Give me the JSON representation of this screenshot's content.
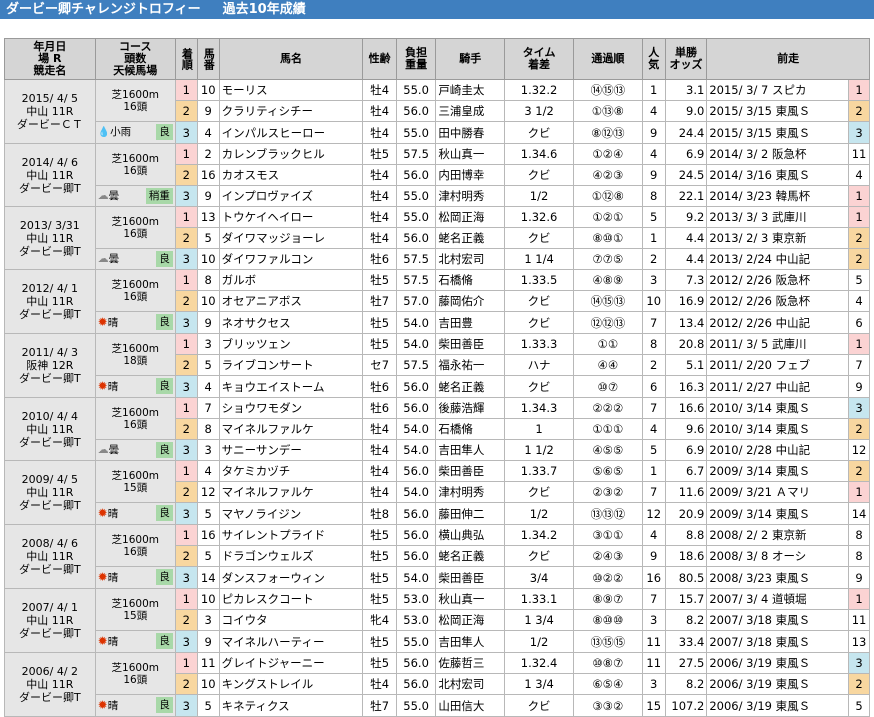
{
  "title": "ダービー卿チャレンジトロフィー",
  "subtitle": "過去10年成績",
  "headers": {
    "date": [
      "年月日",
      "場 R",
      "競走名"
    ],
    "course": [
      "コース",
      "頭数",
      "天候馬場"
    ],
    "pos": "着順",
    "num": "馬番",
    "horse": "馬名",
    "sexage": "性齢",
    "weight": [
      "負担",
      "重量"
    ],
    "jockey": "騎手",
    "time": [
      "タイム",
      "着差"
    ],
    "passing": "通過順",
    "pop": [
      "人",
      "気"
    ],
    "odds": [
      "単勝",
      "オッズ"
    ],
    "prev": "前走"
  },
  "races": [
    {
      "date": "2015/ 4/ 5",
      "venue": "中山 11R",
      "race": "ダービーＣＴ",
      "course": "芝1600m",
      "heads": "16頭",
      "weather": "小雨",
      "weather_icon": "rain-icon",
      "cond": "良",
      "rows": [
        {
          "pos": "1",
          "num": "10",
          "horse": "モーリス",
          "sa": "牡4",
          "wt": "55.0",
          "jockey": "戸崎圭太",
          "time": "1.32.2",
          "pass": "⑭⑮⑬",
          "pop": "1",
          "odds": "3.1",
          "prev": "2015/ 3/ 7 スピカ",
          "prevpos": "1"
        },
        {
          "pos": "2",
          "num": "9",
          "horse": "クラリティシチー",
          "sa": "牡4",
          "wt": "56.0",
          "jockey": "三浦皇成",
          "time": "3 1/2",
          "pass": "①⑬⑧",
          "pop": "4",
          "odds": "9.0",
          "prev": "2015/ 3/15 東風Ｓ",
          "prevpos": "2"
        },
        {
          "pos": "3",
          "num": "4",
          "horse": "インパルスヒーロー",
          "sa": "牡4",
          "wt": "55.0",
          "jockey": "田中勝春",
          "time": "クビ",
          "pass": "⑧⑫⑬",
          "pop": "9",
          "odds": "24.4",
          "prev": "2015/ 3/15 東風Ｓ",
          "prevpos": "3"
        }
      ]
    },
    {
      "date": "2014/ 4/ 6",
      "venue": "中山 11R",
      "race": "ダービー卿T",
      "course": "芝1600m",
      "heads": "16頭",
      "weather": "曇",
      "weather_icon": "cloud-icon",
      "cond": "稍重",
      "rows": [
        {
          "pos": "1",
          "num": "2",
          "horse": "カレンブラックヒル",
          "sa": "牡5",
          "wt": "57.5",
          "jockey": "秋山真一",
          "time": "1.34.6",
          "pass": "①②④",
          "pop": "4",
          "odds": "6.9",
          "prev": "2014/ 3/ 2 阪急杯",
          "prevpos": "11"
        },
        {
          "pos": "2",
          "num": "16",
          "horse": "カオスモス",
          "sa": "牡4",
          "wt": "56.0",
          "jockey": "内田博幸",
          "time": "クビ",
          "pass": "④②③",
          "pop": "9",
          "odds": "24.5",
          "prev": "2014/ 3/16 東風Ｓ",
          "prevpos": "4"
        },
        {
          "pos": "3",
          "num": "9",
          "horse": "インプロヴァイズ",
          "sa": "牡4",
          "wt": "55.0",
          "jockey": "津村明秀",
          "time": "1/2",
          "pass": "①⑫⑧",
          "pop": "8",
          "odds": "22.1",
          "prev": "2014/ 3/23 韓馬杯",
          "prevpos": "1"
        }
      ]
    },
    {
      "date": "2013/ 3/31",
      "venue": "中山 11R",
      "race": "ダービー卿T",
      "course": "芝1600m",
      "heads": "16頭",
      "weather": "曇",
      "weather_icon": "cloud-icon",
      "cond": "良",
      "rows": [
        {
          "pos": "1",
          "num": "13",
          "horse": "トウケイヘイロー",
          "sa": "牡4",
          "wt": "55.0",
          "jockey": "松岡正海",
          "time": "1.32.6",
          "pass": "①②①",
          "pop": "5",
          "odds": "9.2",
          "prev": "2013/ 3/ 3 武庫川",
          "prevpos": "1"
        },
        {
          "pos": "2",
          "num": "5",
          "horse": "ダイワマッジョーレ",
          "sa": "牡4",
          "wt": "56.0",
          "jockey": "蛯名正義",
          "time": "クビ",
          "pass": "⑧⑩①",
          "pop": "1",
          "odds": "4.4",
          "prev": "2013/ 2/ 3 東京新",
          "prevpos": "2"
        },
        {
          "pos": "3",
          "num": "10",
          "horse": "ダイワファルコン",
          "sa": "牡6",
          "wt": "57.5",
          "jockey": "北村宏司",
          "time": "1 1/4",
          "pass": "⑦⑦⑤",
          "pop": "2",
          "odds": "4.4",
          "prev": "2013/ 2/24 中山記",
          "prevpos": "2"
        }
      ]
    },
    {
      "date": "2012/ 4/ 1",
      "venue": "中山 11R",
      "race": "ダービー卿T",
      "course": "芝1600m",
      "heads": "16頭",
      "weather": "晴",
      "weather_icon": "sun-icon",
      "cond": "良",
      "rows": [
        {
          "pos": "1",
          "num": "8",
          "horse": "ガルボ",
          "sa": "牡5",
          "wt": "57.5",
          "jockey": "石橋脩",
          "time": "1.33.5",
          "pass": "④⑧⑨",
          "pop": "3",
          "odds": "7.3",
          "prev": "2012/ 2/26 阪急杯",
          "prevpos": "5"
        },
        {
          "pos": "2",
          "num": "10",
          "horse": "オセアニアボス",
          "sa": "牡7",
          "wt": "57.0",
          "jockey": "藤岡佑介",
          "time": "クビ",
          "pass": "⑭⑮⑬",
          "pop": "10",
          "odds": "16.9",
          "prev": "2012/ 2/26 阪急杯",
          "prevpos": "4"
        },
        {
          "pos": "3",
          "num": "9",
          "horse": "ネオサクセス",
          "sa": "牡5",
          "wt": "54.0",
          "jockey": "吉田豊",
          "time": "クビ",
          "pass": "⑫⑫⑬",
          "pop": "7",
          "odds": "13.4",
          "prev": "2012/ 2/26 中山記",
          "prevpos": "6"
        }
      ]
    },
    {
      "date": "2011/ 4/ 3",
      "venue": "阪神 12R",
      "race": "ダービー卿T",
      "course": "芝1600m",
      "heads": "18頭",
      "weather": "晴",
      "weather_icon": "sun-icon",
      "cond": "良",
      "rows": [
        {
          "pos": "1",
          "num": "3",
          "horse": "ブリッツェン",
          "sa": "牡5",
          "wt": "54.0",
          "jockey": "柴田善臣",
          "time": "1.33.3",
          "pass": "①①",
          "pop": "8",
          "odds": "20.8",
          "prev": "2011/ 3/ 5 武庫川",
          "prevpos": "1"
        },
        {
          "pos": "2",
          "num": "5",
          "horse": "ライブコンサート",
          "sa": "セ7",
          "wt": "57.5",
          "jockey": "福永祐一",
          "time": "ハナ",
          "pass": "④④",
          "pop": "2",
          "odds": "5.1",
          "prev": "2011/ 2/20 フェブ",
          "prevpos": "7"
        },
        {
          "pos": "3",
          "num": "4",
          "horse": "キョウエイストーム",
          "sa": "牡6",
          "wt": "56.0",
          "jockey": "蛯名正義",
          "time": "クビ",
          "pass": "⑩⑦",
          "pop": "6",
          "odds": "16.3",
          "prev": "2011/ 2/27 中山記",
          "prevpos": "9"
        }
      ]
    },
    {
      "date": "2010/ 4/ 4",
      "venue": "中山 11R",
      "race": "ダービー卿T",
      "course": "芝1600m",
      "heads": "16頭",
      "weather": "曇",
      "weather_icon": "cloud-icon",
      "cond": "良",
      "rows": [
        {
          "pos": "1",
          "num": "7",
          "horse": "ショウワモダン",
          "sa": "牡6",
          "wt": "56.0",
          "jockey": "後藤浩輝",
          "time": "1.34.3",
          "pass": "②②②",
          "pop": "7",
          "odds": "16.6",
          "prev": "2010/ 3/14 東風Ｓ",
          "prevpos": "3"
        },
        {
          "pos": "2",
          "num": "8",
          "horse": "マイネルファルケ",
          "sa": "牡4",
          "wt": "54.0",
          "jockey": "石橋脩",
          "time": "1",
          "pass": "①①①",
          "pop": "4",
          "odds": "9.6",
          "prev": "2010/ 3/14 東風Ｓ",
          "prevpos": "2"
        },
        {
          "pos": "3",
          "num": "3",
          "horse": "サニーサンデー",
          "sa": "牡4",
          "wt": "54.0",
          "jockey": "吉田隼人",
          "time": "1 1/2",
          "pass": "④⑤⑤",
          "pop": "5",
          "odds": "6.9",
          "prev": "2010/ 2/28 中山記",
          "prevpos": "12"
        }
      ]
    },
    {
      "date": "2009/ 4/ 5",
      "venue": "中山 11R",
      "race": "ダービー卿T",
      "course": "芝1600m",
      "heads": "15頭",
      "weather": "晴",
      "weather_icon": "sun-icon",
      "cond": "良",
      "rows": [
        {
          "pos": "1",
          "num": "4",
          "horse": "タケミカヅチ",
          "sa": "牡4",
          "wt": "56.0",
          "jockey": "柴田善臣",
          "time": "1.33.7",
          "pass": "⑤⑥⑤",
          "pop": "1",
          "odds": "6.7",
          "prev": "2009/ 3/14 東風Ｓ",
          "prevpos": "2"
        },
        {
          "pos": "2",
          "num": "12",
          "horse": "マイネルファルケ",
          "sa": "牡4",
          "wt": "54.0",
          "jockey": "津村明秀",
          "time": "クビ",
          "pass": "②③②",
          "pop": "7",
          "odds": "11.6",
          "prev": "2009/ 3/21 Ａマリ",
          "prevpos": "1"
        },
        {
          "pos": "3",
          "num": "5",
          "horse": "マヤノライジン",
          "sa": "牡8",
          "wt": "56.0",
          "jockey": "藤田伸二",
          "time": "1/2",
          "pass": "⑬⑬⑫",
          "pop": "12",
          "odds": "20.9",
          "prev": "2009/ 3/14 東風Ｓ",
          "prevpos": "14"
        }
      ]
    },
    {
      "date": "2008/ 4/ 6",
      "venue": "中山 11R",
      "race": "ダービー卿T",
      "course": "芝1600m",
      "heads": "16頭",
      "weather": "晴",
      "weather_icon": "sun-icon",
      "cond": "良",
      "rows": [
        {
          "pos": "1",
          "num": "16",
          "horse": "サイレントプライド",
          "sa": "牡5",
          "wt": "56.0",
          "jockey": "横山典弘",
          "time": "1.34.2",
          "pass": "③①①",
          "pop": "4",
          "odds": "8.8",
          "prev": "2008/ 2/ 2 東京新",
          "prevpos": "8"
        },
        {
          "pos": "2",
          "num": "5",
          "horse": "ドラゴンウェルズ",
          "sa": "牡5",
          "wt": "56.0",
          "jockey": "蛯名正義",
          "time": "クビ",
          "pass": "②④③",
          "pop": "9",
          "odds": "18.6",
          "prev": "2008/ 3/ 8 オーシ",
          "prevpos": "8"
        },
        {
          "pos": "3",
          "num": "14",
          "horse": "ダンスフォーウィン",
          "sa": "牡5",
          "wt": "54.0",
          "jockey": "柴田善臣",
          "time": "3/4",
          "pass": "⑩②②",
          "pop": "16",
          "odds": "80.5",
          "prev": "2008/ 3/23 東風Ｓ",
          "prevpos": "9"
        }
      ]
    },
    {
      "date": "2007/ 4/ 1",
      "venue": "中山 11R",
      "race": "ダービー卿T",
      "course": "芝1600m",
      "heads": "15頭",
      "weather": "晴",
      "weather_icon": "sun-icon",
      "cond": "良",
      "rows": [
        {
          "pos": "1",
          "num": "10",
          "horse": "ピカレスクコート",
          "sa": "牡5",
          "wt": "53.0",
          "jockey": "秋山真一",
          "time": "1.33.1",
          "pass": "⑧⑨⑦",
          "pop": "7",
          "odds": "15.7",
          "prev": "2007/ 3/ 4 道頓堀",
          "prevpos": "1"
        },
        {
          "pos": "2",
          "num": "3",
          "horse": "コイウタ",
          "sa": "牝4",
          "wt": "53.0",
          "jockey": "松岡正海",
          "time": "1 3/4",
          "pass": "⑧⑩⑩",
          "pop": "3",
          "odds": "8.2",
          "prev": "2007/ 3/18 東風Ｓ",
          "prevpos": "11"
        },
        {
          "pos": "3",
          "num": "9",
          "horse": "マイネルハーティー",
          "sa": "牡5",
          "wt": "55.0",
          "jockey": "吉田隼人",
          "time": "1/2",
          "pass": "⑬⑮⑮",
          "pop": "11",
          "odds": "33.4",
          "prev": "2007/ 3/18 東風Ｓ",
          "prevpos": "13"
        }
      ]
    },
    {
      "date": "2006/ 4/ 2",
      "venue": "中山 11R",
      "race": "ダービー卿T",
      "course": "芝1600m",
      "heads": "16頭",
      "weather": "晴",
      "weather_icon": "sun-icon",
      "cond": "良",
      "rows": [
        {
          "pos": "1",
          "num": "11",
          "horse": "グレイトジャーニー",
          "sa": "牡5",
          "wt": "56.0",
          "jockey": "佐藤哲三",
          "time": "1.32.4",
          "pass": "⑩⑧⑦",
          "pop": "11",
          "odds": "27.5",
          "prev": "2006/ 3/19 東風Ｓ",
          "prevpos": "3"
        },
        {
          "pos": "2",
          "num": "10",
          "horse": "キングストレイル",
          "sa": "牡4",
          "wt": "56.0",
          "jockey": "北村宏司",
          "time": "1 3/4",
          "pass": "⑥⑤④",
          "pop": "3",
          "odds": "8.2",
          "prev": "2006/ 3/19 東風Ｓ",
          "prevpos": "2"
        },
        {
          "pos": "3",
          "num": "5",
          "horse": "キネティクス",
          "sa": "牡7",
          "wt": "55.0",
          "jockey": "山田信大",
          "time": "クビ",
          "pass": "③③②",
          "pop": "15",
          "odds": "107.2",
          "prev": "2006/ 3/19 東風Ｓ",
          "prevpos": "5"
        }
      ]
    }
  ]
}
